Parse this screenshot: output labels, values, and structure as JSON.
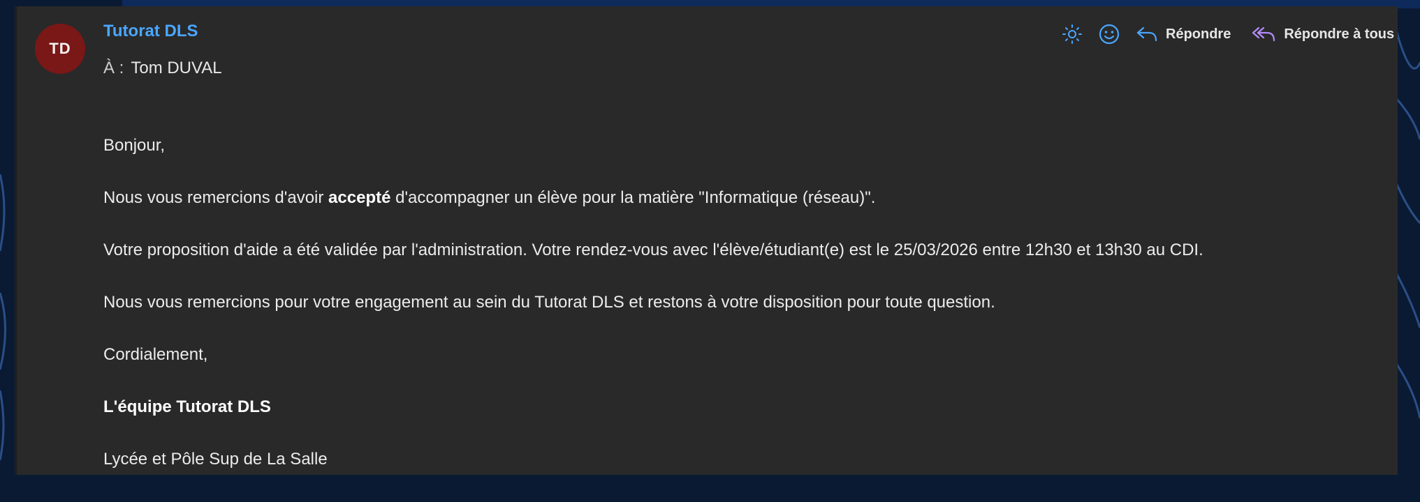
{
  "email": {
    "sender": {
      "initials": "TD",
      "name": "Tutorat DLS",
      "avatar_color": "#7a1717",
      "name_color": "#4aa6ff"
    },
    "recipient": {
      "label": "À :",
      "name": "Tom DUVAL"
    },
    "actions": [
      {
        "icon": "brightness-icon"
      },
      {
        "icon": "emoji-icon"
      },
      {
        "icon": "reply-icon",
        "label": "Répondre"
      },
      {
        "icon": "reply-all-icon",
        "label": "Répondre à tous"
      }
    ],
    "body": {
      "greeting": "Bonjour,",
      "line1_before": "Nous vous remercions d'avoir ",
      "line1_bold": "accepté",
      "line1_after": " d'accompagner un élève pour la matière \"Informatique (réseau)\".",
      "line2": "Votre proposition d'aide a été validée par l'administration. Votre rendez-vous avec l'élève/étudiant(e) est le 25/03/2026 entre 12h30 et 13h30 au CDI.",
      "line3": "Nous vous remercions pour votre engagement au sein du Tutorat DLS et restons à votre disposition pour toute question.",
      "closing": "Cordialement,",
      "signature_team": "L'équipe Tutorat DLS",
      "signature_school": "Lycée et Pôle Sup de La Salle"
    }
  },
  "colors": {
    "pane_bg": "#292929",
    "desktop_bg": "#0b1a33",
    "reply_all_icon": "#b48cff",
    "icon_blue": "#4aa6ff"
  }
}
